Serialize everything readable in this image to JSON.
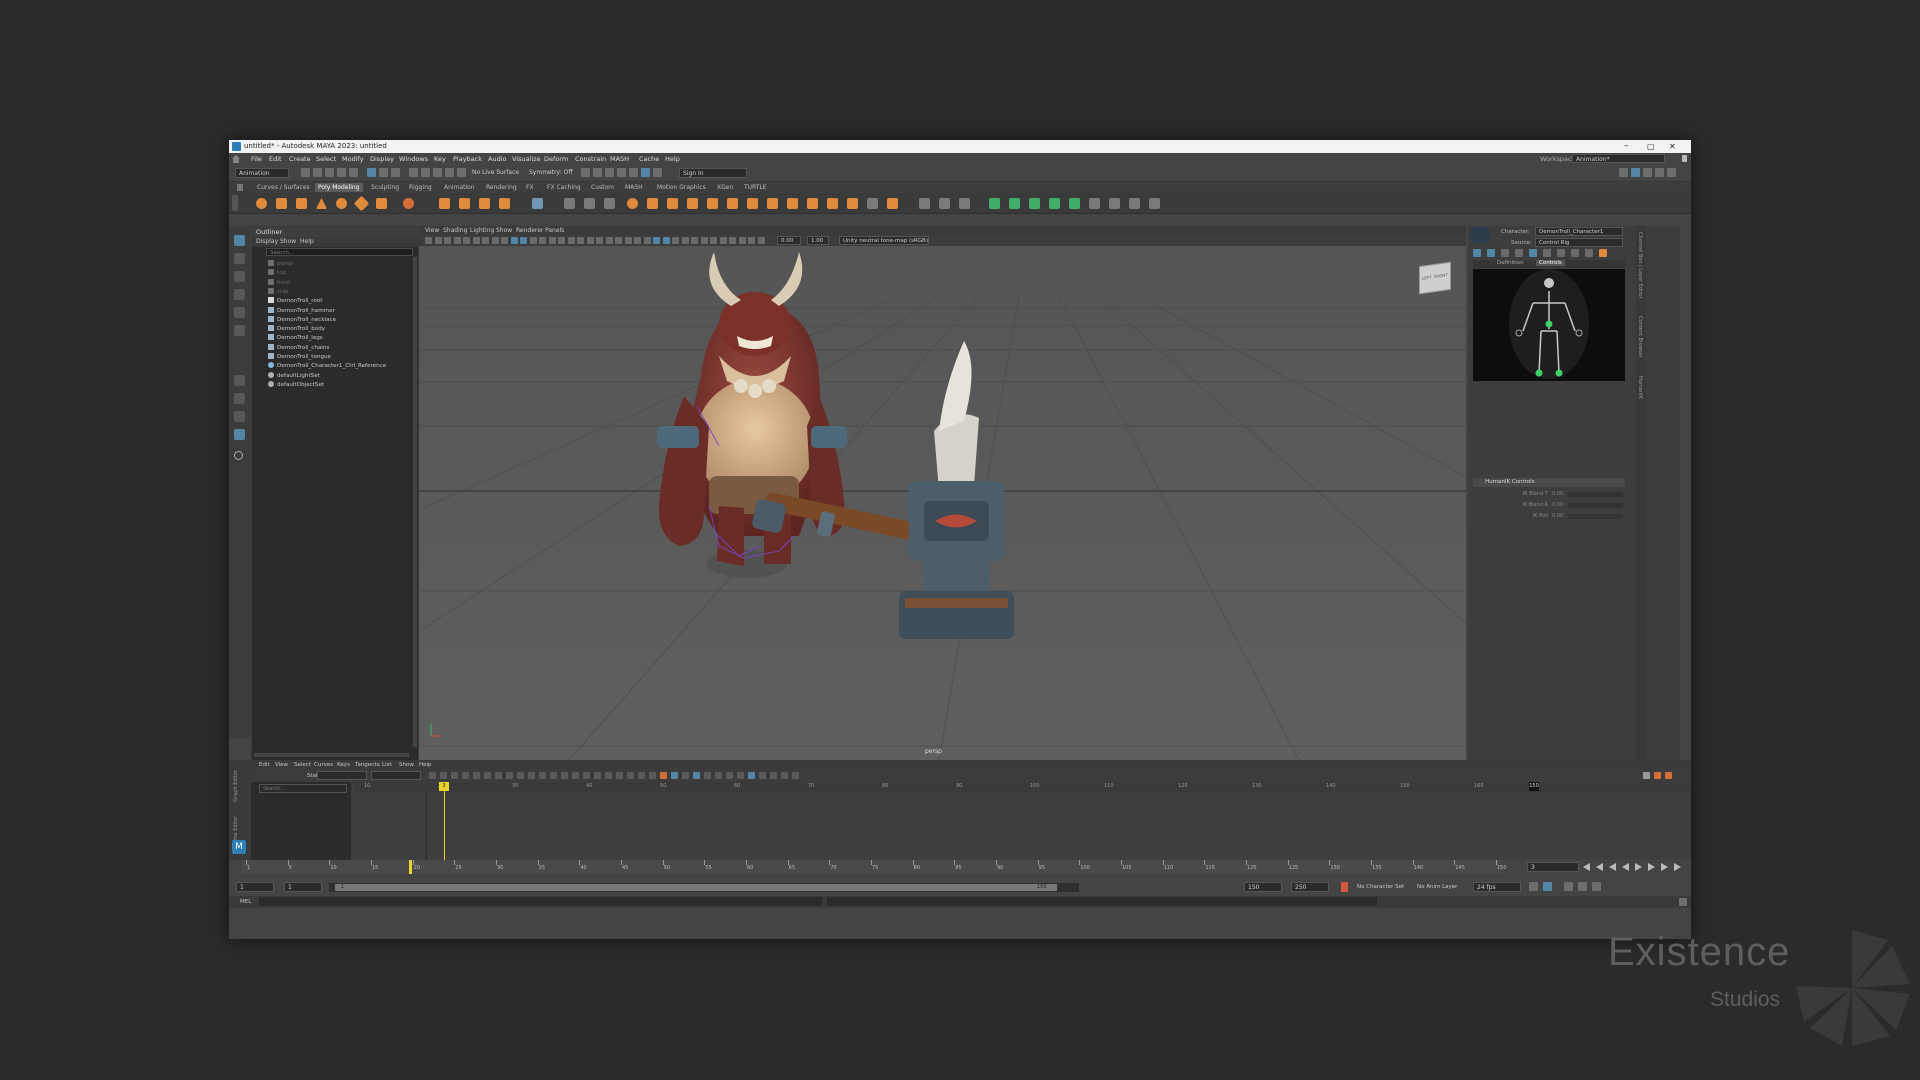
{
  "window": {
    "title": "untitled* - Autodesk MAYA 2023: untitled",
    "min": "–",
    "max": "▢",
    "close": "✕"
  },
  "menu": [
    "File",
    "Edit",
    "Create",
    "Select",
    "Modify",
    "Display",
    "Windows",
    "Key",
    "Playback",
    "Audio",
    "Visualize",
    "Deform",
    "Constrain",
    "MASH",
    "Cache",
    "Help"
  ],
  "status": {
    "menuset": "Animation",
    "live_surface": "No Live Surface",
    "symmetry": "Symmetry: Off",
    "sign_in": "Sign In",
    "workspace_label": "Workspace:",
    "workspace": "Animation*"
  },
  "shelf_tabs": [
    "Curves / Surfaces",
    "Poly Modeling",
    "Sculpting",
    "Rigging",
    "Animation",
    "Rendering",
    "FX",
    "FX Caching",
    "Custom",
    "MASH",
    "Motion Graphics",
    "XGen",
    "TURTLE"
  ],
  "shelf_active": "Poly Modeling",
  "outliner": {
    "title": "Outliner",
    "menu": [
      "Display",
      "Show",
      "Help"
    ],
    "search": "Search...",
    "items": [
      {
        "label": "persp",
        "type": "camera",
        "dim": true
      },
      {
        "label": "top",
        "type": "camera",
        "dim": true
      },
      {
        "label": "front",
        "type": "camera",
        "dim": true
      },
      {
        "label": "side",
        "type": "camera",
        "dim": true
      },
      {
        "label": "DemonTroll_root",
        "type": "joint",
        "dim": false
      },
      {
        "label": "DemonTroll_hammer",
        "type": "mesh",
        "dim": false
      },
      {
        "label": "DemonTroll_necklace",
        "type": "mesh",
        "dim": false
      },
      {
        "label": "DemonTroll_body",
        "type": "mesh",
        "dim": false
      },
      {
        "label": "DemonTroll_legs",
        "type": "mesh",
        "dim": false
      },
      {
        "label": "DemonTroll_chains",
        "type": "mesh",
        "dim": false
      },
      {
        "label": "DemonTroll_tongue",
        "type": "mesh",
        "dim": false
      },
      {
        "label": "DemonTroll_Character1_Ctrl_Reference",
        "type": "ref",
        "dim": false
      },
      {
        "label": "defaultLightSet",
        "type": "set",
        "dim": false
      },
      {
        "label": "defaultObjectSet",
        "type": "set",
        "dim": false
      }
    ]
  },
  "viewport": {
    "menu": [
      "View",
      "Shading",
      "Lighting",
      "Show",
      "Renderer",
      "Panels"
    ],
    "field1": "0.00",
    "field2": "1.00",
    "colorspace": "Unity neutral tone-map (sRGB)",
    "camera_label": "persp",
    "viewcube_left": "LEFT",
    "viewcube_front": "FRONT"
  },
  "hik": {
    "character_label": "Character:",
    "character": "DemonTroll_Character1",
    "source_label": "Source:",
    "source": "Control Rig",
    "tabs": [
      "Definition",
      "Controls"
    ],
    "active_tab": "Controls",
    "section": "HumanIK Controls",
    "sliders": [
      {
        "label": "IK Blend T",
        "value": "0.00"
      },
      {
        "label": "IK Blend R",
        "value": "0.00"
      },
      {
        "label": "IK Pull",
        "value": "0.00"
      }
    ],
    "side_tabs": [
      "Channel Box / Layer Editor",
      "Content Browser",
      "HumanIK"
    ]
  },
  "graph_editor": {
    "menu": [
      "Edit",
      "View",
      "Select",
      "Curves",
      "Keys",
      "Tangents",
      "List",
      "Show",
      "Help"
    ],
    "stats_label": "Stats",
    "search": "Search...",
    "side_tabs": [
      "Graph Editor",
      "Time Editor"
    ],
    "ruler": [
      "10",
      "20",
      "30",
      "40",
      "50",
      "60",
      "70",
      "80",
      "90",
      "100",
      "110",
      "120",
      "130",
      "140",
      "150",
      "160"
    ],
    "current_frame_marker": "3",
    "end_marker": "150"
  },
  "timeline": {
    "ticks": [
      "1",
      "5",
      "10",
      "15",
      "20",
      "25",
      "30",
      "35",
      "40",
      "45",
      "50",
      "55",
      "60",
      "65",
      "70",
      "75",
      "80",
      "85",
      "90",
      "95",
      "100",
      "105",
      "110",
      "115",
      "120",
      "125",
      "130",
      "135",
      "140",
      "145",
      "150"
    ],
    "current_frame": "3",
    "range_start": "1",
    "range_start_inner": "1",
    "range_slider_start": "1",
    "range_slider_end": "150",
    "range_end_inner": "150",
    "range_end": "250",
    "character_set": "No Character Set",
    "anim_layer": "No Anim Layer",
    "fps": "24 fps",
    "cmd_lang": "MEL"
  },
  "watermark": {
    "line1": "Existence",
    "line2": "Studios"
  },
  "colors": {
    "accent": "#5285a6",
    "shelf_orange": "#e08a3c",
    "shelf_green": "#3fae6a",
    "keyframe_yellow": "#e8d62c"
  }
}
